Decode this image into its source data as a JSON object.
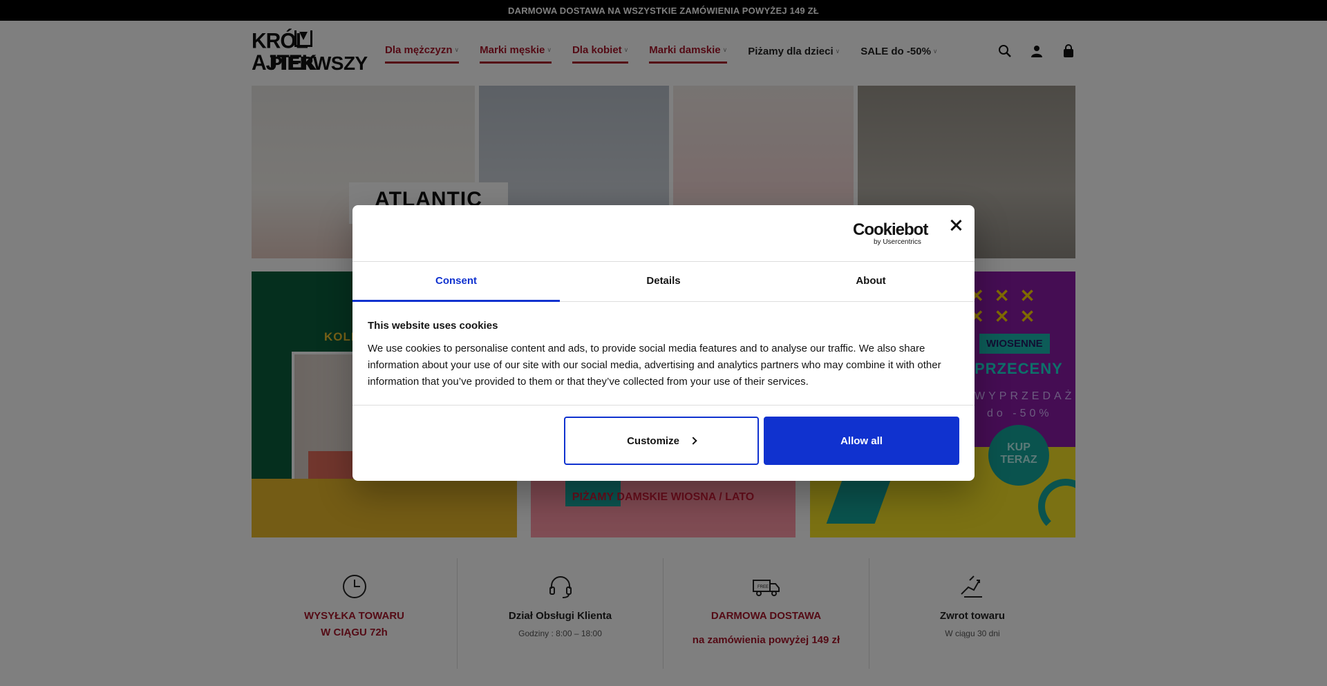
{
  "topbar": {
    "text": "DARMOWA DOSTAWA NA WSZYSTKIE ZAMÓWIENIA POWYŻEJ 149 ZŁ"
  },
  "logo": {
    "line1": "KRÓL  AJTEK",
    "line2": "PIERWSZY"
  },
  "nav": [
    {
      "label": "Dla mężczyzn",
      "style": "red"
    },
    {
      "label": "Marki męskie",
      "style": "red"
    },
    {
      "label": "Dla kobiet",
      "style": "red"
    },
    {
      "label": "Marki damskie",
      "style": "red"
    },
    {
      "label": "Piżamy dla dzieci",
      "style": "dark"
    },
    {
      "label": "SALE do -50%",
      "style": "dark"
    }
  ],
  "header_icons": [
    "search-icon",
    "account-icon",
    "cart-icon"
  ],
  "banner1": {
    "brand_text": "ATLANTIC"
  },
  "banner2": {
    "left_text": "KOLE",
    "middle_text": "PIŻAMY DAMSKIE WIOSNA / LATO",
    "right_tag": "WIOSENNE",
    "right_title": "PRZECENY",
    "right_line1": "WYPRZEDAŻ",
    "right_line2": "do -50%",
    "right_cta_line1": "KUP",
    "right_cta_line2": "TERAZ"
  },
  "features": [
    {
      "icon": "clock-icon",
      "title_line1": "WYSYŁKA TOWARU",
      "title_line2": "W CIĄGU 72h",
      "sub": ""
    },
    {
      "icon": "headset-icon",
      "title_line1": "Dział Obsługi Klienta",
      "title_line2": "",
      "sub": "Godziny : 8:00 – 18:00"
    },
    {
      "icon": "truck-icon",
      "title_line1": "DARMOWA DOSTAWA",
      "title_line2": "",
      "sub": "na zamówienia powyżej 149 zł"
    },
    {
      "icon": "return-icon",
      "title_line1": "Zwrot towaru",
      "title_line2": "",
      "sub": "W ciągu 30 dni"
    }
  ],
  "cookie_dialog": {
    "brand": "Cookiebot",
    "brand_sub": "by Usercentrics",
    "tabs": [
      "Consent",
      "Details",
      "About"
    ],
    "active_tab": "Consent",
    "heading": "This website uses cookies",
    "body": "We use cookies to personalise content and ads, to provide social media features and to analyse our traffic. We also share information about your use of our site with our social media, advertising and analytics partners who may combine it with other information that you’ve provided to them or that they’ve collected from your use of their services.",
    "customize_label": "Customize",
    "allow_label": "Allow all",
    "accent_color": "#1032cf"
  },
  "colors": {
    "brand_red": "#a8172b",
    "overlay": "rgba(0,0,0,0.5)"
  }
}
